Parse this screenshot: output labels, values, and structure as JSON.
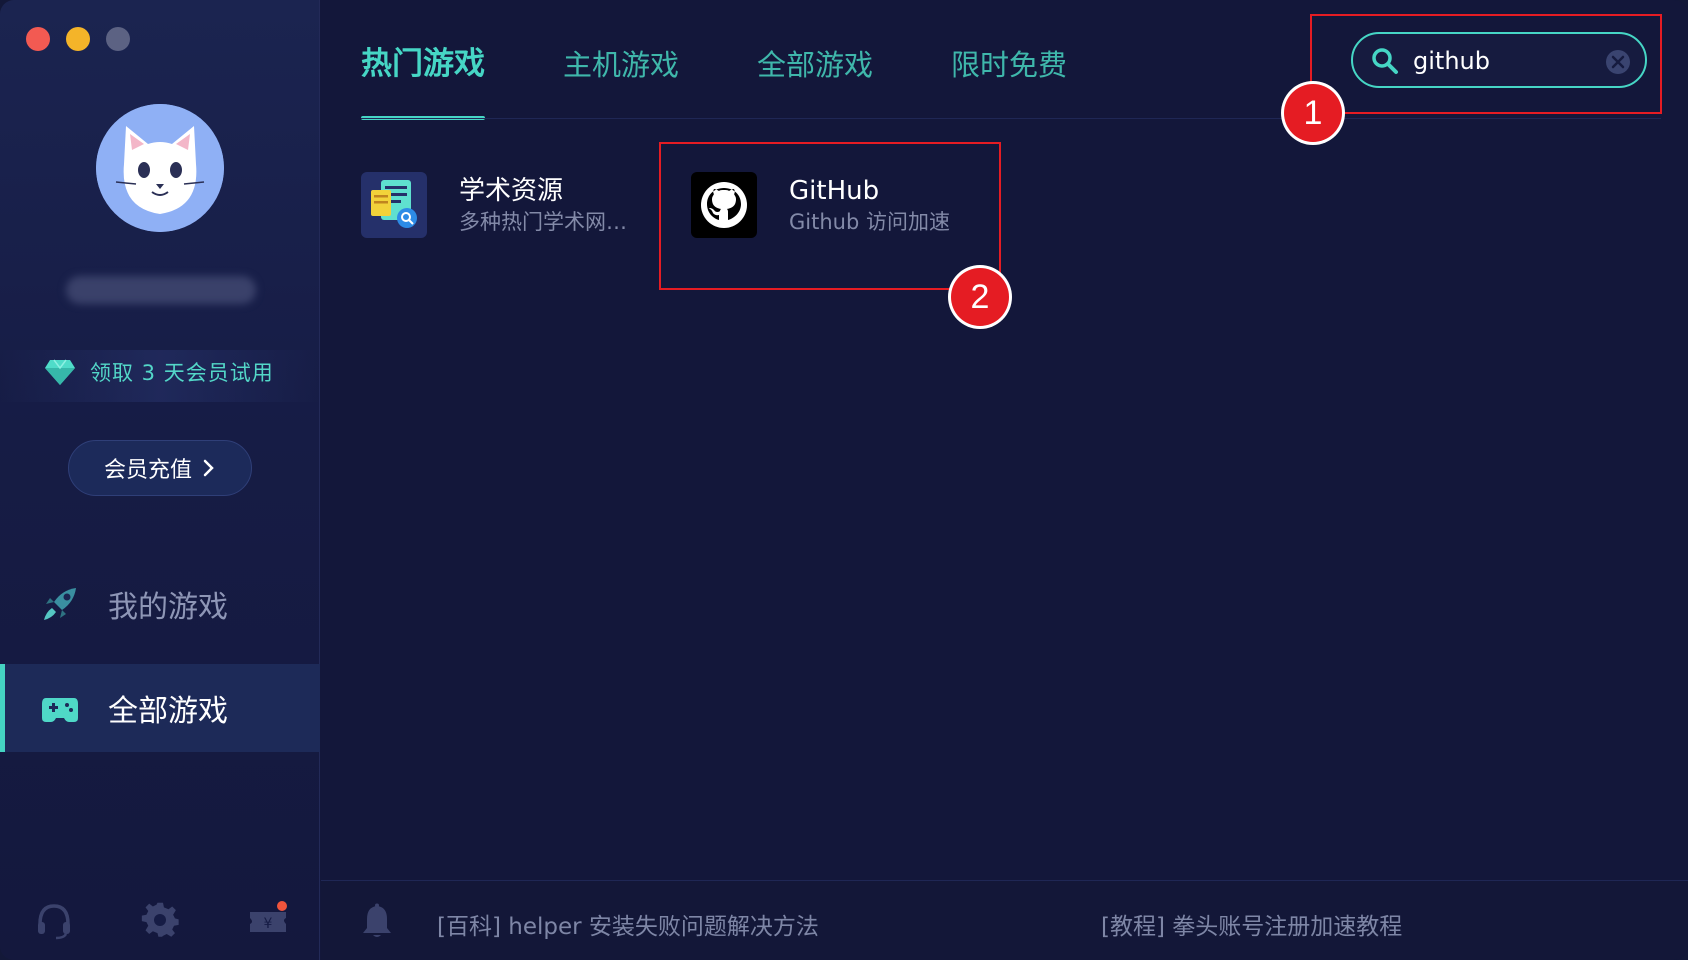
{
  "window": {
    "controls": [
      "close",
      "minimize",
      "maximize"
    ]
  },
  "sidebar": {
    "trial_label": "领取 3 天会员试用",
    "recharge_label": "会员充值",
    "nav": [
      {
        "label": "我的游戏",
        "icon": "rocket-icon",
        "active": false
      },
      {
        "label": "全部游戏",
        "icon": "gamepad-icon",
        "active": true
      }
    ],
    "bottom_icons": [
      "headset-icon",
      "gear-icon",
      "ticket-icon"
    ]
  },
  "tabs": [
    {
      "label": "热门游戏",
      "active": true
    },
    {
      "label": "主机游戏",
      "active": false
    },
    {
      "label": "全部游戏",
      "active": false
    },
    {
      "label": "限时免费",
      "active": false
    }
  ],
  "search": {
    "value": "github",
    "icon": "search-icon",
    "clear_icon": "clear-icon"
  },
  "results": [
    {
      "title": "学术资源",
      "subtitle": "多种热门学术网…",
      "icon": "academic-resource-icon"
    },
    {
      "title": "GitHub",
      "subtitle": "Github 访问加速",
      "icon": "github-icon"
    }
  ],
  "annotations": [
    {
      "number": "1"
    },
    {
      "number": "2"
    }
  ],
  "footer": {
    "news": [
      "[百科] helper 安装失败问题解决方法",
      "[教程] 拳头账号注册加速教程"
    ]
  },
  "colors": {
    "accent": "#46d6c5",
    "background": "#13173a",
    "annotation": "#e51c23"
  }
}
